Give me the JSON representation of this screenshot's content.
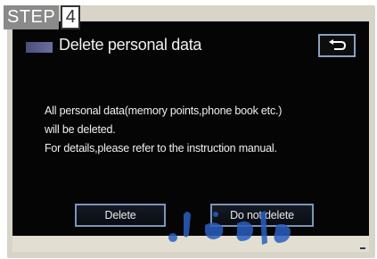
{
  "step": {
    "label": "STEP",
    "number": "4"
  },
  "dialog": {
    "title": "Delete personal data",
    "title_icon": "folder-icon",
    "back_icon": "return-arrow-icon",
    "message": [
      "All personal data(memory points,phone book etc.)",
      "will be deleted.",
      "For details,please refer to the instruction manual."
    ],
    "buttons": {
      "delete": "Delete",
      "do_not_delete": "Do not delete"
    }
  },
  "colors": {
    "screen_background": "#050505",
    "button_border": "#7c94b8",
    "step_badge": "#8a8a8a",
    "watermark": "#2a5fc0"
  }
}
